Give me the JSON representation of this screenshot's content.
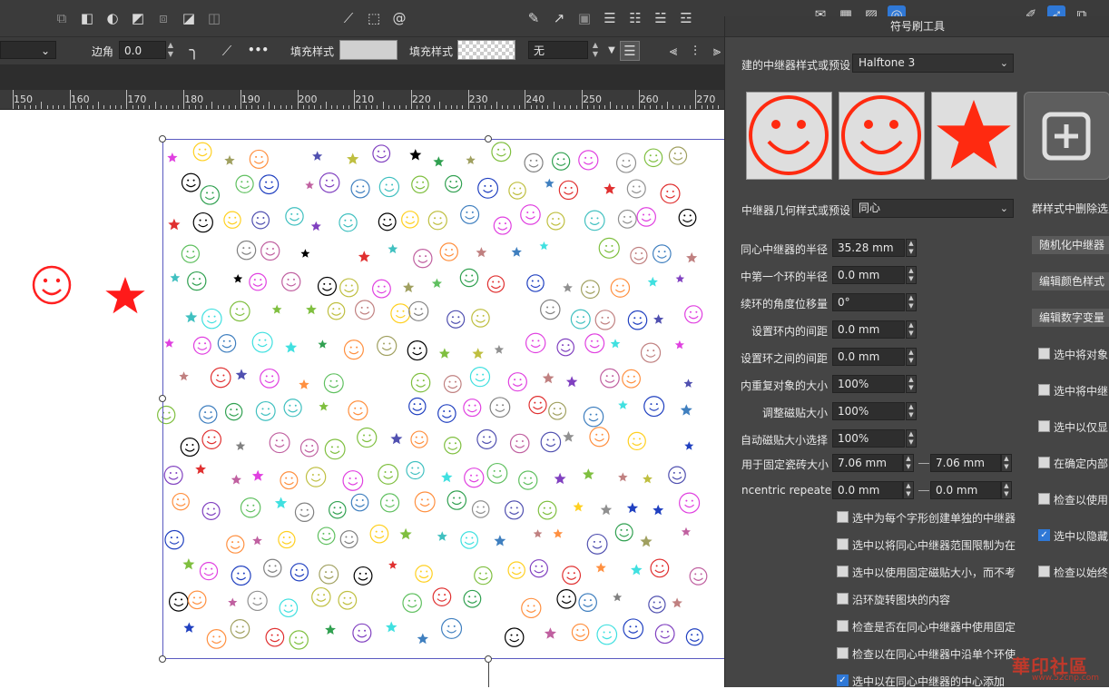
{
  "toolbar": {
    "corner_label": "边角",
    "corner_value": "0.0 mm",
    "fill_label_1": "填充样式",
    "fill_label_2": "填充样式",
    "fill_value": "无",
    "more_icon": "•••"
  },
  "ruler": {
    "ticks": [
      "150",
      "160",
      "170",
      "180",
      "190",
      "200",
      "210",
      "220",
      "230",
      "240",
      "250",
      "260",
      "270"
    ]
  },
  "panel": {
    "title": "符号刷工具",
    "style_label": "建的中继器样式或预设",
    "style_value": "Halftone 3",
    "geometry_label": "中继器几何样式或预设",
    "geometry_value": "同心",
    "rows": [
      {
        "label": "同心中继器的半径",
        "value": "35.28 mm"
      },
      {
        "label": "中第一个环的半径",
        "value": "0.0 mm"
      },
      {
        "label": "续环的角度位移量",
        "value": "0°"
      },
      {
        "label": "设置环内的间距",
        "value": "0.0 mm"
      },
      {
        "label": "设置环之间的间距",
        "value": "0.0 mm"
      },
      {
        "label": "内重复对象的大小",
        "value": "100%"
      },
      {
        "label": "调整磁贴大小",
        "value": "100%"
      },
      {
        "label": "自动磁贴大小选择",
        "value": "100%"
      }
    ],
    "fixed_tile_label": "用于固定瓷砖大小",
    "fixed_tile_a": "7.06 mm",
    "fixed_tile_b": "7.06 mm",
    "concentric_label": "ncentric repeater",
    "concentric_a": "0.0 mm",
    "concentric_b": "0.0 mm",
    "checks_left": [
      {
        "text": "选中为每个字形创建单独的中继器",
        "checked": false
      },
      {
        "text": "选中以将同心中继器范围限制为在",
        "checked": false
      },
      {
        "text": "选中以使用固定磁贴大小，而不考",
        "checked": false
      },
      {
        "text": "沿环旋转图块的内容",
        "checked": false
      },
      {
        "text": "检查是否在同心中继器中使用固定",
        "checked": false
      },
      {
        "text": "检查以在同心中继器中沿单个环使",
        "checked": false
      },
      {
        "text": "选中以在同心中继器的中心添加",
        "checked": true
      }
    ],
    "buttons_right": [
      "群样式中删除选定",
      "随机化中继器",
      "编辑颜色样式",
      "编辑数字变量"
    ],
    "checks_right": [
      {
        "text": "选中将对象",
        "checked": false
      },
      {
        "text": "选中将中继",
        "checked": false
      },
      {
        "text": "选中以仅显",
        "checked": false
      },
      {
        "text": "在确定内部",
        "checked": false
      },
      {
        "text": "检查以使用",
        "checked": false
      },
      {
        "text": "选中以隐藏",
        "checked": true
      },
      {
        "text": "检查以始终",
        "checked": false
      }
    ]
  },
  "watermark": {
    "text": "華印社區",
    "url": "www.52cnp.com"
  },
  "colors": {
    "accent": "#2f78d6",
    "preset_red": "#ff2a10",
    "panel_bg": "#454545",
    "toolbar_bg": "#3b3b3b"
  }
}
